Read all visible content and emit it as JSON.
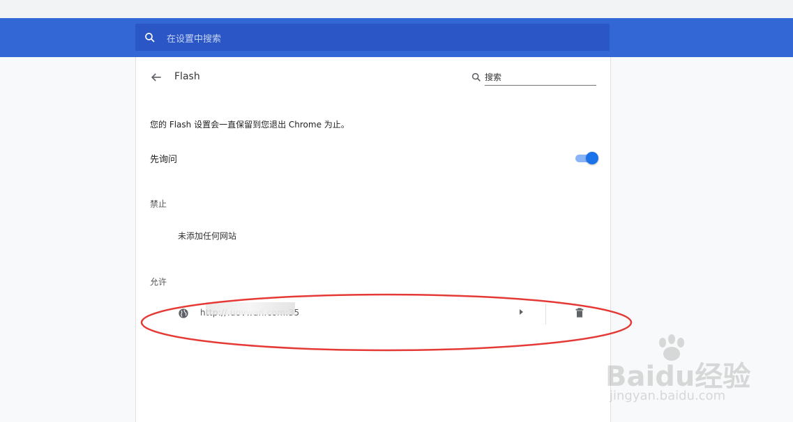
{
  "header": {
    "search_placeholder": "在设置中搜索"
  },
  "page": {
    "title": "Flash",
    "search_placeholder": "搜索",
    "description": "您的 Flash 设置会一直保留到您退出 Chrome 为止。",
    "ask_first_label": "先询问",
    "ask_first_enabled": true
  },
  "blocked": {
    "heading": "禁止",
    "empty_text": "未添加任何网站"
  },
  "allowed": {
    "heading": "允许",
    "sites": [
      {
        "url": "http://.uovwan.com:35"
      }
    ]
  },
  "watermark": {
    "brand": "Baidu经验",
    "domain": "jingyan.baidu.com"
  },
  "colors": {
    "toolbar": "#3367d6",
    "toggle": "#1a73e8",
    "annotation": "#e53935"
  }
}
